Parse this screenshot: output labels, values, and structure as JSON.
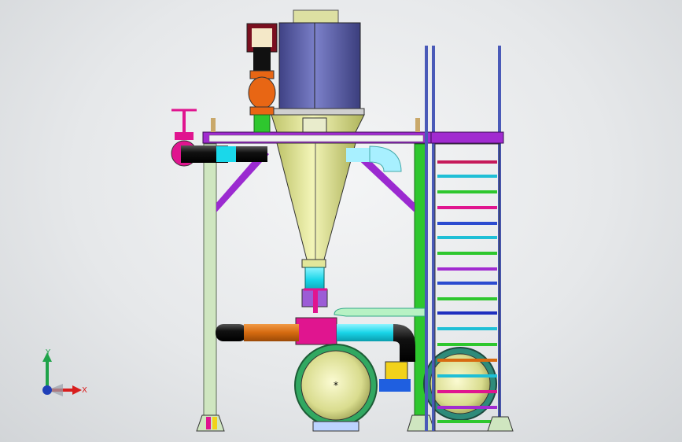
{
  "viewport": {
    "background": "#e8eaec"
  },
  "triad": {
    "y_label": "Y",
    "x_label": "X",
    "y_color": "#1fa34a",
    "x_color": "#d81e1e",
    "z_color": "#1f3fb8"
  },
  "model": {
    "components": [
      "cyclone-cylinder",
      "cyclone-cone",
      "support-frame",
      "platform-deck",
      "access-ladder",
      "gate-valve",
      "butterfly-valve",
      "orange-pipe",
      "cyan-pipe",
      "black-elbow-pipe",
      "vessel-left",
      "vessel-right",
      "pink-valve-handwheel"
    ],
    "colors": {
      "cylinder": "#5b5fa8",
      "cone": "#e2e69a",
      "frame_green": "#cfe6c0",
      "platform_purple": "#a12bd0",
      "pipe_orange": "#d86a10",
      "pipe_cyan": "#1ad8ea",
      "valve_magenta": "#e0158f",
      "vessel_rim": "#31a861",
      "ladder_green": "#27b827"
    }
  }
}
